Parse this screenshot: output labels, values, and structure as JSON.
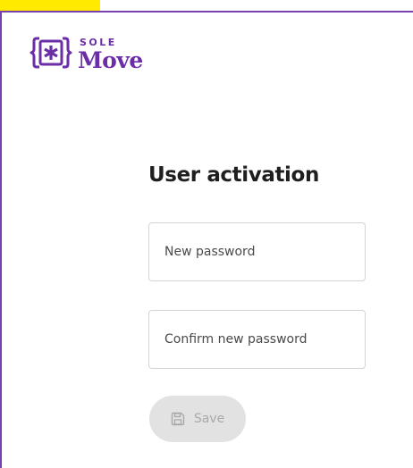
{
  "brand": {
    "line1": "SOLE",
    "line2": "Move",
    "icon": "asterisk-braces-icon",
    "color": "#6b2ea6"
  },
  "page": {
    "title": "User activation"
  },
  "form": {
    "new_password_placeholder": "New password",
    "confirm_password_placeholder": "Confirm new password",
    "save_label": "Save",
    "save_icon": "floppy-disk-icon",
    "save_enabled": false
  },
  "colors": {
    "accent": "#7a3fb1",
    "highlight": "#ffea00",
    "button_disabled_bg": "#e2e2e2"
  }
}
